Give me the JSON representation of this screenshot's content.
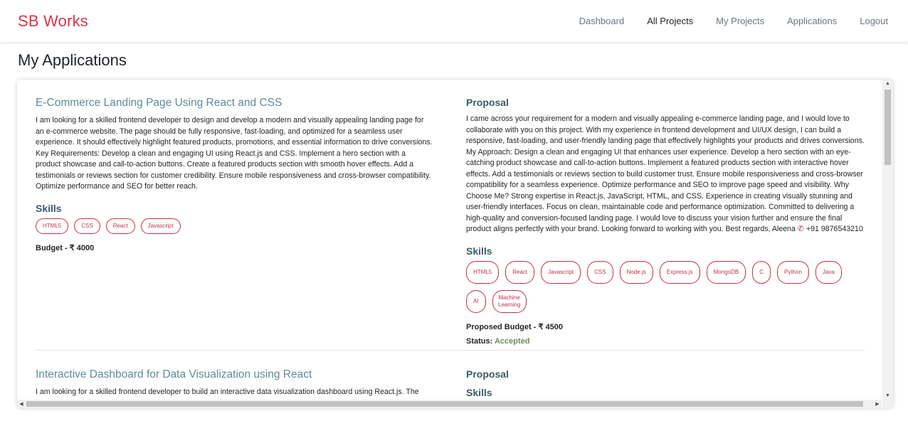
{
  "navbar": {
    "brand": "SB Works",
    "links": [
      "Dashboard",
      "All Projects",
      "My Projects",
      "Applications",
      "Logout"
    ]
  },
  "page": {
    "title": "My Applications"
  },
  "applications": [
    {
      "project_title": "E-Commerce Landing Page Using React and CSS",
      "description": "I am looking for a skilled frontend developer to design and develop a modern and visually appealing landing page for an e-commerce website. The page should be fully responsive, fast-loading, and optimized for a seamless user experience. It should effectively highlight featured products, promotions, and essential information to drive conversions. Key Requirements: Develop a clean and engaging UI using React.js and CSS. Implement a hero section with a product showcase and call-to-action buttons. Create a featured products section with smooth hover effects. Add a testimonials or reviews section for customer credibility. Ensure mobile responsiveness and cross-browser compatibility. Optimize performance and SEO for better reach.",
      "skills_heading": "Skills",
      "skills": [
        "HTML5",
        "CSS",
        "React",
        "Javascript"
      ],
      "budget_label": "Budget - ",
      "budget_value": "₹ 4000",
      "proposal_heading": "Proposal",
      "proposal_text": "I came across your requirement for a modern and visually appealing e-commerce landing page, and I would love to collaborate with you on this project. With my experience in frontend development and UI/UX design, I can build a responsive, fast-loading, and user-friendly landing page that effectively highlights your products and drives conversions. My Approach: Design a clean and engaging UI that enhances user experience. Develop a hero section with an eye-catching product showcase and call-to-action buttons. Implement a featured products section with interactive hover effects. Add a testimonials or reviews section to build customer trust. Ensure mobile responsiveness and cross-browser compatibility for a seamless experience. Optimize performance and SEO to improve page speed and visibility. Why Choose Me? Strong expertise in React.js, JavaScript, HTML, and CSS. Experience in creating visually stunning and user-friendly interfaces. Focus on clean, maintainable code and performance optimization. Committed to delivering a high-quality and conversion-focused landing page. I would love to discuss your vision further and ensure the final product aligns perfectly with your brand. Looking forward to working with you. Best regards, Aleena",
      "phone_icon": "phone-icon",
      "phone": "+91 9876543210",
      "freelancer_skills_heading": "Skills",
      "freelancer_skills": [
        "HTML5",
        "React",
        "Javascript",
        "CSS",
        "Node.js",
        "Express.js",
        "MongoDB",
        "C",
        "Python",
        "Java",
        "AI",
        "Machine Learning"
      ],
      "proposed_budget_label": "Proposed Budget - ",
      "proposed_budget_value": "₹ 4500",
      "status_label": "Status: ",
      "status_value": "Accepted"
    },
    {
      "project_title": "Interactive Dashboard for Data Visualization using React",
      "description": "I am looking for a skilled frontend developer to build an interactive data visualization dashboard using React.js. The",
      "proposal_heading": "Proposal",
      "skills_heading": "Skills"
    }
  ],
  "colors": {
    "brand": "#dc3545",
    "title": "#5e8aa0",
    "pill": "#c4314b",
    "accepted": "#6d8a60"
  }
}
